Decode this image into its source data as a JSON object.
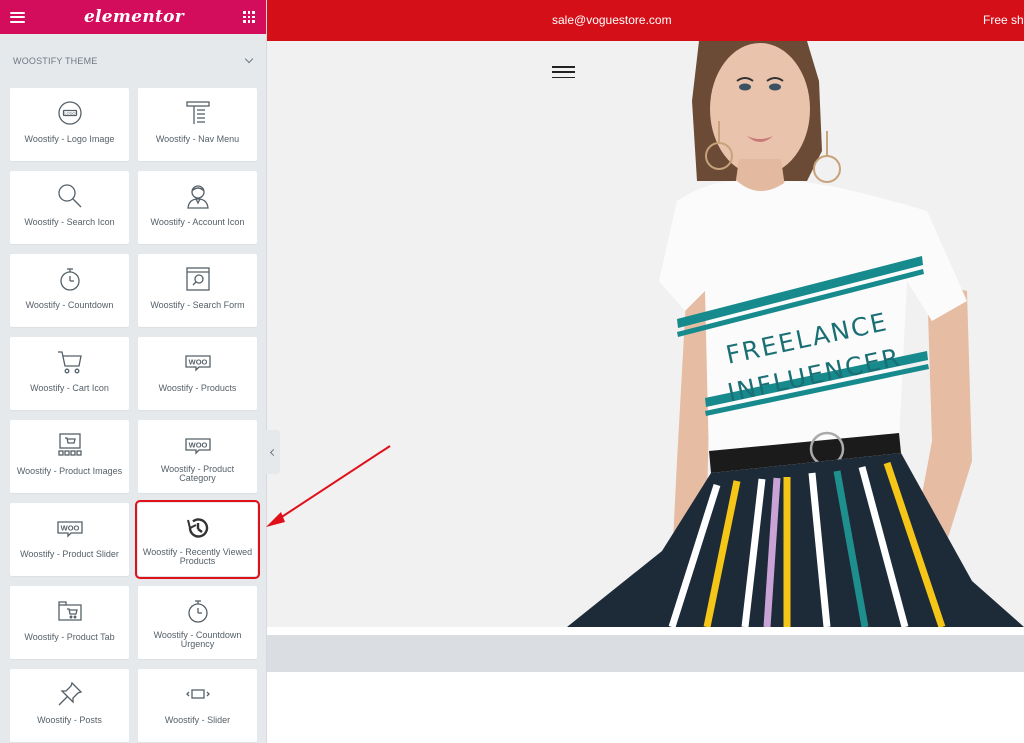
{
  "sidebar": {
    "header": {
      "logo_text": "elementor",
      "hamburger_icon": "hamburger-icon",
      "grid_icon": "grid-icon"
    },
    "category": {
      "title": "WOOSTIFY THEME",
      "icon": "chevron-down-icon"
    },
    "widgets": [
      {
        "label": "Woostify - Logo Image",
        "icon": "logo-icon"
      },
      {
        "label": "Woostify - Nav Menu",
        "icon": "nav-menu-icon"
      },
      {
        "label": "Woostify - Search Icon",
        "icon": "search-icon"
      },
      {
        "label": "Woostify - Account Icon",
        "icon": "account-icon"
      },
      {
        "label": "Woostify - Countdown",
        "icon": "stopwatch-icon"
      },
      {
        "label": "Woostify - Search Form",
        "icon": "search-form-icon"
      },
      {
        "label": "Woostify - Cart Icon",
        "icon": "cart-icon"
      },
      {
        "label": "Woostify - Products",
        "icon": "woo-icon"
      },
      {
        "label": "Woostify - Product Images",
        "icon": "product-images-icon"
      },
      {
        "label": "Woostify - Product Category",
        "icon": "woo-icon"
      },
      {
        "label": "Woostify - Product Slider",
        "icon": "woo-icon"
      },
      {
        "label": "Woostify - Recently Viewed Products",
        "icon": "history-icon",
        "highlighted": true
      },
      {
        "label": "Woostify - Product Tab",
        "icon": "product-tab-icon"
      },
      {
        "label": "Woostify - Countdown Urgency",
        "icon": "stopwatch-icon"
      },
      {
        "label": "Woostify - Posts",
        "icon": "pushpin-icon"
      },
      {
        "label": "Woostify - Slider",
        "icon": "slider-icon"
      }
    ]
  },
  "preview": {
    "topbar": {
      "email": "sale@voguestore.com",
      "shipping": "Free shi"
    },
    "hero": {
      "shirt_line1": "FREELANCE",
      "shirt_line2": "INFLUENCER",
      "menu_icon": "hamburger-icon"
    }
  },
  "colors": {
    "brand": "#d30c5c",
    "topbar": "#d50f18",
    "highlight": "#e0101a"
  }
}
